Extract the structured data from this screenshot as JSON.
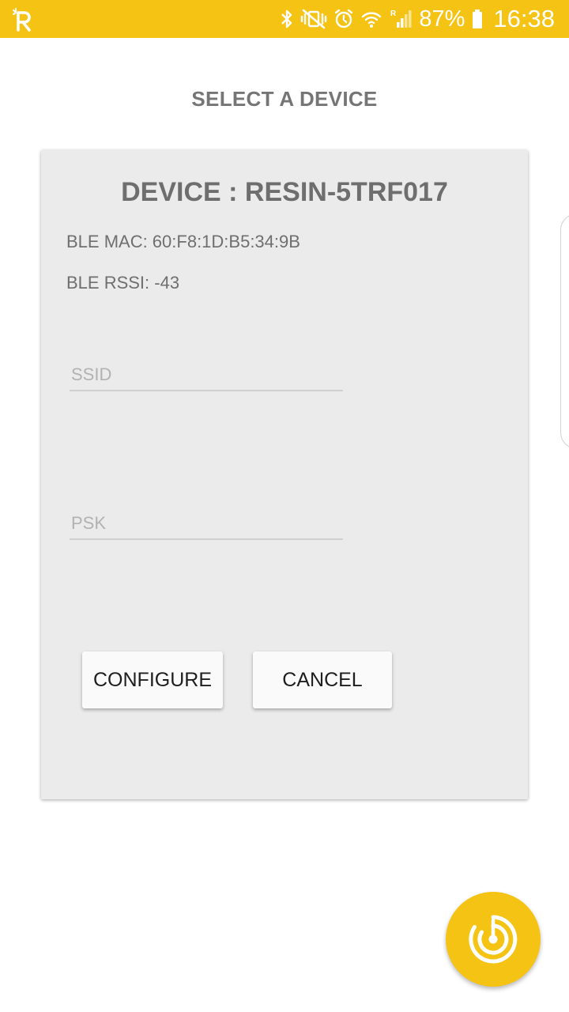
{
  "status_bar": {
    "background_color": "#f5c313",
    "app_icon": "resin-r-logo-icon",
    "icons": [
      "bluetooth-icon",
      "vibrate-mute-icon",
      "alarm-icon",
      "wifi-icon",
      "cell-signal-roaming-icon",
      "battery-icon"
    ],
    "battery_percent": "87%",
    "time": "16:38"
  },
  "page": {
    "title": "SELECT A DEVICE"
  },
  "card": {
    "device_title": "DEVICE : RESIN-5TRF017",
    "ble_mac": "BLE MAC: 60:F8:1D:B5:34:9B",
    "ble_rssi": "BLE RSSI: -43",
    "ssid": {
      "value": "",
      "placeholder": "SSID"
    },
    "psk": {
      "value": "",
      "placeholder": "PSK"
    },
    "configure_label": "CONFIGURE",
    "cancel_label": "CANCEL"
  },
  "fab": {
    "icon": "radar-scan-icon",
    "color": "#f5c313"
  }
}
